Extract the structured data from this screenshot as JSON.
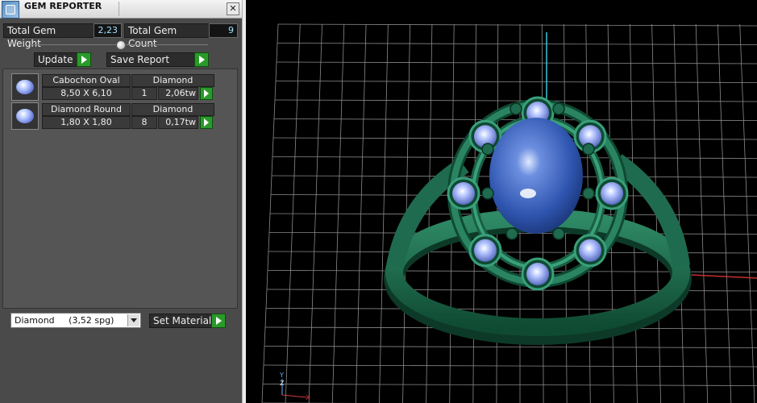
{
  "window": {
    "title": "GEM REPORTER",
    "close_label": "✕"
  },
  "totals": {
    "weight_label": "Total Gem Weight",
    "weight_value": "2,23",
    "count_label": "Total Gem Count",
    "count_value": "9"
  },
  "toolbar": {
    "update_label": "Update",
    "save_report_label": "Save Report"
  },
  "gems": [
    {
      "shape": "Cabochon Oval",
      "material": "Diamond",
      "size": "8,50 X 6,10",
      "count": "1",
      "weight": "2,06tw"
    },
    {
      "shape": "Diamond Round",
      "material": "Diamond",
      "size": "1,80 X 1,80",
      "count": "8",
      "weight": "0,17tw"
    }
  ],
  "material_select": {
    "value": "Diamond     (3,52 spg)"
  },
  "set_material_label": "Set Material",
  "viewport": {
    "axis_labels": [
      "Y",
      "Z",
      "X"
    ],
    "colors": {
      "metal": "#1f6b4f",
      "center_stone": "#3a62b8",
      "accent_stones": "#8aa6ff",
      "grid": "#8a8a8a"
    }
  }
}
